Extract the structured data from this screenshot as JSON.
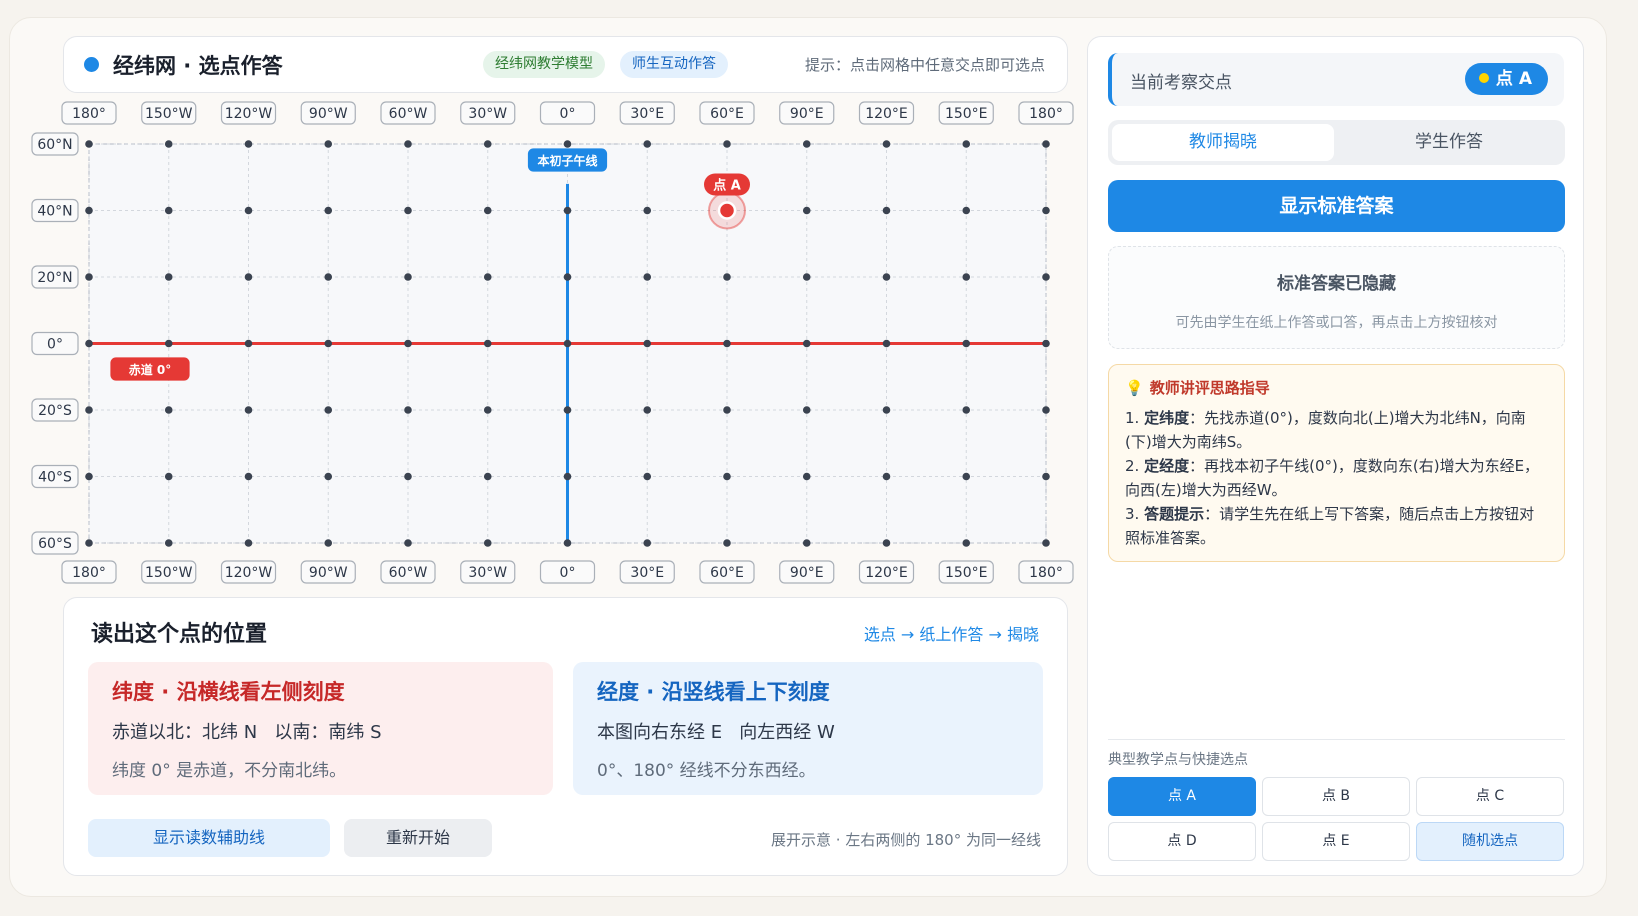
{
  "header": {
    "title": "经纬网 · 选点作答",
    "tag_model": "经纬网教学模型",
    "tag_interact": "师生互动作答",
    "hint": "提示：点击网格中任意交点即可选点"
  },
  "map": {
    "lon_labels": [
      "180°",
      "150°W",
      "120°W",
      "90°W",
      "60°W",
      "30°W",
      "0°",
      "30°E",
      "60°E",
      "90°E",
      "120°E",
      "150°E",
      "180°"
    ],
    "lat_labels": [
      "60°N",
      "40°N",
      "20°N",
      "0°",
      "20°S",
      "40°S",
      "60°S"
    ],
    "lon_values": [
      -180,
      -150,
      -120,
      -90,
      -60,
      -30,
      0,
      30,
      60,
      90,
      120,
      150,
      180
    ],
    "lat_values": [
      60,
      40,
      20,
      0,
      -20,
      -40,
      -60
    ],
    "meridian_label": "本初子午线",
    "equator_label": "赤道 0°",
    "point": {
      "label": "点 A",
      "lon": 60,
      "lat": 40
    },
    "colors": {
      "equator": "#e53935",
      "meridian": "#1e88e5",
      "point": "#e53935"
    }
  },
  "reading": {
    "title": "读出这个点的位置",
    "flow": "选点 → 纸上作答 → 揭晓",
    "lat_panel": {
      "heading": "纬度 · 沿横线看左侧刻度",
      "line1": "赤道以北：北纬 N   以南：南纬 S",
      "line2": "纬度 0° 是赤道，不分南北纬。"
    },
    "lon_panel": {
      "heading": "经度 · 沿竖线看上下刻度",
      "line1": "本图向右东经 E   向左西经 W",
      "line2": "0°、180° 经线不分东西经。"
    },
    "btn_aux": "显示读数辅助线",
    "btn_reset": "重新开始",
    "note": "展开示意 · 左右两侧的 180° 为同一经线"
  },
  "side": {
    "focus_label": "当前考察交点",
    "focus_point": "点 A",
    "tab_teacher": "教师揭晓",
    "tab_student": "学生作答",
    "btn_show": "显示标准答案",
    "hidden_title": "标准答案已隐藏",
    "hidden_desc": "可先由学生在纸上作答或口答，再点击上方按钮核对",
    "guide_title": "教师讲评思路指导",
    "guide": [
      {
        "num": "1. ",
        "key": "定纬度",
        "text": "：先找赤道(0°)，度数向北(上)增大为北纬N，向南(下)增大为南纬S。"
      },
      {
        "num": "2. ",
        "key": "定经度",
        "text": "：再找本初子午线(0°)，度数向东(右)增大为东经E，向西(左)增大为西经W。"
      },
      {
        "num": "3. ",
        "key": "答题提示",
        "text": "：请学生先在纸上写下答案，随后点击上方按钮对照标准答案。"
      }
    ],
    "quick_label": "典型教学点与快捷选点",
    "quick_buttons": [
      "点 A",
      "点 B",
      "点 C",
      "点 D",
      "点 E",
      "随机选点"
    ]
  }
}
